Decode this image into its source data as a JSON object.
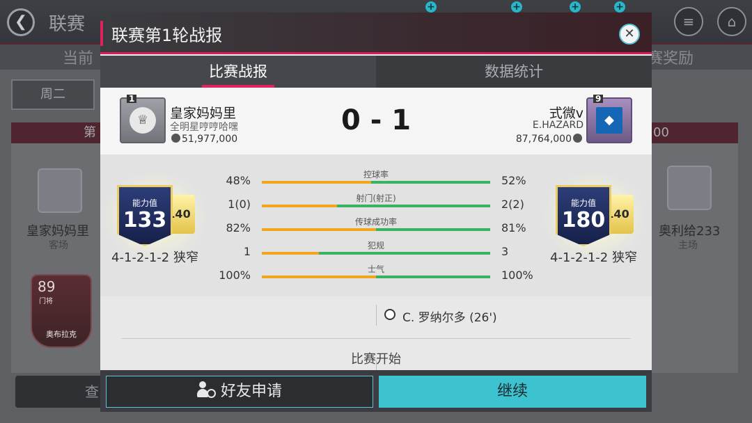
{
  "background": {
    "title": "联赛",
    "tab_left": "当前",
    "tab_right": "赛奖励",
    "day_button": "周二",
    "card_left_header": "第",
    "card_right_header": "00",
    "home_name": "皇家妈妈里",
    "home_side": "客场",
    "away_name": "奥利给233",
    "away_side": "主场",
    "player": {
      "rating": "89",
      "position": "门将",
      "name": "奥布拉克"
    },
    "bottom_button": "查"
  },
  "modal": {
    "title": "联赛第1轮战报",
    "tabs": [
      {
        "label": "比赛战报",
        "active": true
      },
      {
        "label": "数据统计",
        "active": false
      }
    ],
    "home": {
      "crest_badge": "1",
      "name": "皇家妈妈里",
      "subtitle": "全明星哼哼哈嘿",
      "power": "51,977,000",
      "rating_label": "能力值",
      "rating": "133",
      "rating_tag": "140",
      "formation": "4-1-2-1-2 狭窄"
    },
    "away": {
      "crest_badge": "9",
      "name": "式微v",
      "subtitle": "E.HAZARD",
      "power": "87,764,000",
      "rating_label": "能力值",
      "rating": "180",
      "rating_tag": "140",
      "formation": "4-1-2-1-2 狭窄"
    },
    "score": "0 - 1",
    "stats": [
      {
        "label": "控球率",
        "home": "48%",
        "away": "52%",
        "home_share": 0.48
      },
      {
        "label": "射门(射正)",
        "home": "1(0)",
        "away": "2(2)",
        "home_share": 0.33
      },
      {
        "label": "传球成功率",
        "home": "82%",
        "away": "81%",
        "home_share": 0.5
      },
      {
        "label": "犯规",
        "home": "1",
        "away": "3",
        "home_share": 0.25
      },
      {
        "label": "士气",
        "home": "100%",
        "away": "100%",
        "home_share": 0.5
      }
    ],
    "events": [
      {
        "text": "C. 罗纳尔多 (26')",
        "side": "away",
        "icon": "football-icon"
      }
    ],
    "event_start": "比赛开始",
    "friend_button": "好友申请",
    "continue_button": "继续"
  },
  "colors": {
    "accent_pink": "#d3205a",
    "accent_cyan": "#3dc3cf",
    "home_bar": "#f2a51f",
    "away_bar": "#3bb262"
  }
}
